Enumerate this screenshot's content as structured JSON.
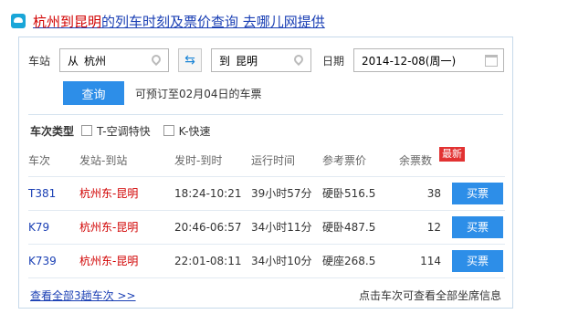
{
  "header": {
    "title_red": "杭州到昆明",
    "title_rest": "的列车时刻及票价查询 去哪儿网提供"
  },
  "search": {
    "station_label": "车站",
    "from_prefix": "从",
    "from_value": "杭州",
    "to_prefix": "到",
    "to_value": "昆明",
    "swap_icon": "⇆",
    "date_label": "日期",
    "date_value": "2014-12-08(周一)",
    "query_button": "查询",
    "presale_hint": "可预订至02月04日的车票"
  },
  "filter": {
    "title": "车次类型",
    "options": [
      "T-空调特快",
      "K-快速"
    ]
  },
  "table": {
    "headers": [
      "车次",
      "发站-到站",
      "发时-到时",
      "运行时间",
      "参考票价",
      "余票数",
      ""
    ],
    "badge": "最新",
    "rows": [
      {
        "train": "T381",
        "from": "杭州东",
        "sep": "-",
        "to": "昆明",
        "times": "18:24-10:21",
        "duration": "39小时57分",
        "price": "硬卧516.5",
        "remaining": "38",
        "buy": "买票"
      },
      {
        "train": "K79",
        "from": "杭州",
        "sep": "东-",
        "to": "昆明",
        "times": "20:46-06:57",
        "duration": "34小时11分",
        "price": "硬卧487.5",
        "remaining": "12",
        "buy": "买票"
      },
      {
        "train": "K739",
        "from": "杭州东",
        "sep": "-",
        "to": "昆明",
        "times": "22:01-08:11",
        "duration": "34小时10分",
        "price": "硬座268.5",
        "remaining": "114",
        "buy": "买票"
      }
    ]
  },
  "footer": {
    "view_all": "查看全部3趟车次 >>",
    "tip": "点击车次可查看全部坐席信息"
  },
  "colors": {
    "accent": "#2d8ee8",
    "link": "#1a3fb4",
    "highlight": "#d10000",
    "badge": "#e23232"
  }
}
